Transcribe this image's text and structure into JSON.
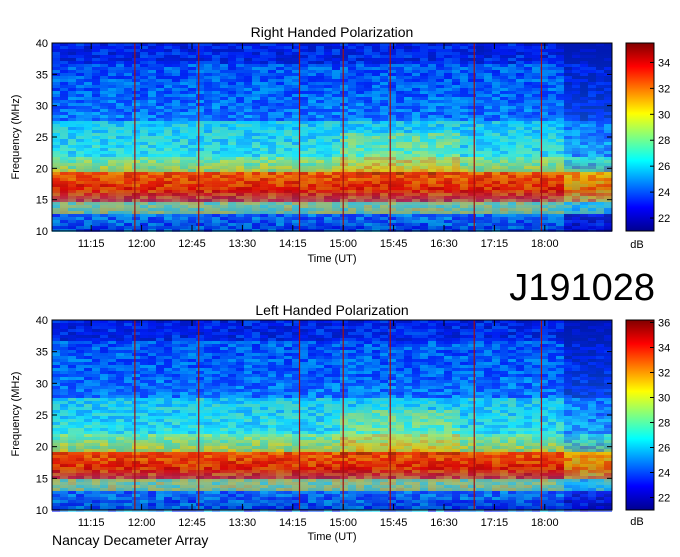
{
  "observation_id": "J191028",
  "footer": "Nancay Decameter Array",
  "colormap": [
    "#00008f",
    "#0000ff",
    "#0080ff",
    "#00ffff",
    "#80ff80",
    "#ffff00",
    "#ff8000",
    "#ff0000",
    "#800000"
  ],
  "chart_data": [
    {
      "type": "heatmap",
      "title": "Right Handed Polarization",
      "xlabel": "Time (UT)",
      "ylabel": "Frequency (MHz)",
      "x_ticks": [
        "11:15",
        "12:00",
        "12:45",
        "13:30",
        "14:15",
        "15:00",
        "15:45",
        "16:30",
        "17:15",
        "18:00"
      ],
      "x_range": [
        "10:40",
        "19:00"
      ],
      "y_ticks": [
        10,
        15,
        20,
        25,
        30,
        35,
        40
      ],
      "y_range": [
        10,
        40
      ],
      "colorbar": {
        "unit": "dB",
        "ticks": [
          22,
          24,
          26,
          28,
          30,
          32,
          34
        ],
        "range": [
          21,
          35.5
        ]
      }
    },
    {
      "type": "heatmap",
      "title": "Left Handed Polarization",
      "xlabel": "Time (UT)",
      "ylabel": "Frequency (MHz)",
      "x_ticks": [
        "11:15",
        "12:00",
        "12:45",
        "13:30",
        "14:15",
        "15:00",
        "15:45",
        "16:30",
        "17:15",
        "18:00"
      ],
      "x_range": [
        "10:40",
        "19:00"
      ],
      "y_ticks": [
        10,
        15,
        20,
        25,
        30,
        35,
        40
      ],
      "y_range": [
        10,
        40
      ],
      "colorbar": {
        "unit": "dB",
        "ticks": [
          22,
          24,
          26,
          28,
          30,
          32,
          34,
          36
        ],
        "range": [
          21,
          36.2
        ]
      }
    }
  ]
}
